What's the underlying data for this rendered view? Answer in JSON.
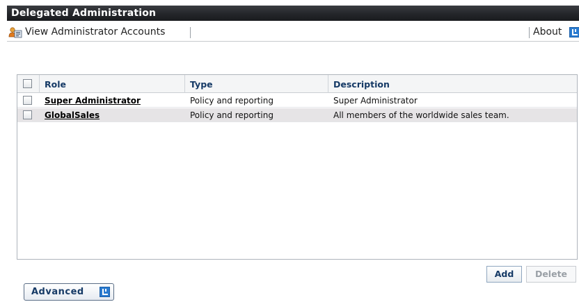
{
  "app": {
    "title": "Delegated Administration"
  },
  "nav": {
    "view_accounts_label": "View Administrator Accounts",
    "view_accounts_icon": "admin-accounts-icon",
    "about_label": "About",
    "about_icon": "external-link-icon"
  },
  "table": {
    "columns": [
      "Role",
      "Type",
      "Description"
    ],
    "rows": [
      {
        "role": "Super Administrator",
        "type": "Policy and reporting",
        "description": "Super Administrator",
        "checked": false
      },
      {
        "role": "GlobalSales",
        "type": "Policy and reporting",
        "description": "All members of the worldwide sales team.",
        "checked": false
      }
    ]
  },
  "actions": {
    "add_label": "Add",
    "delete_label": "Delete",
    "delete_enabled": false
  },
  "advanced": {
    "label": "Advanced",
    "icon": "external-link-icon"
  },
  "colors": {
    "titlebar": "#24262a",
    "header_text": "#163a66",
    "alt_row": "#e6e4e6",
    "accent_icon": "#2a7bd0"
  }
}
